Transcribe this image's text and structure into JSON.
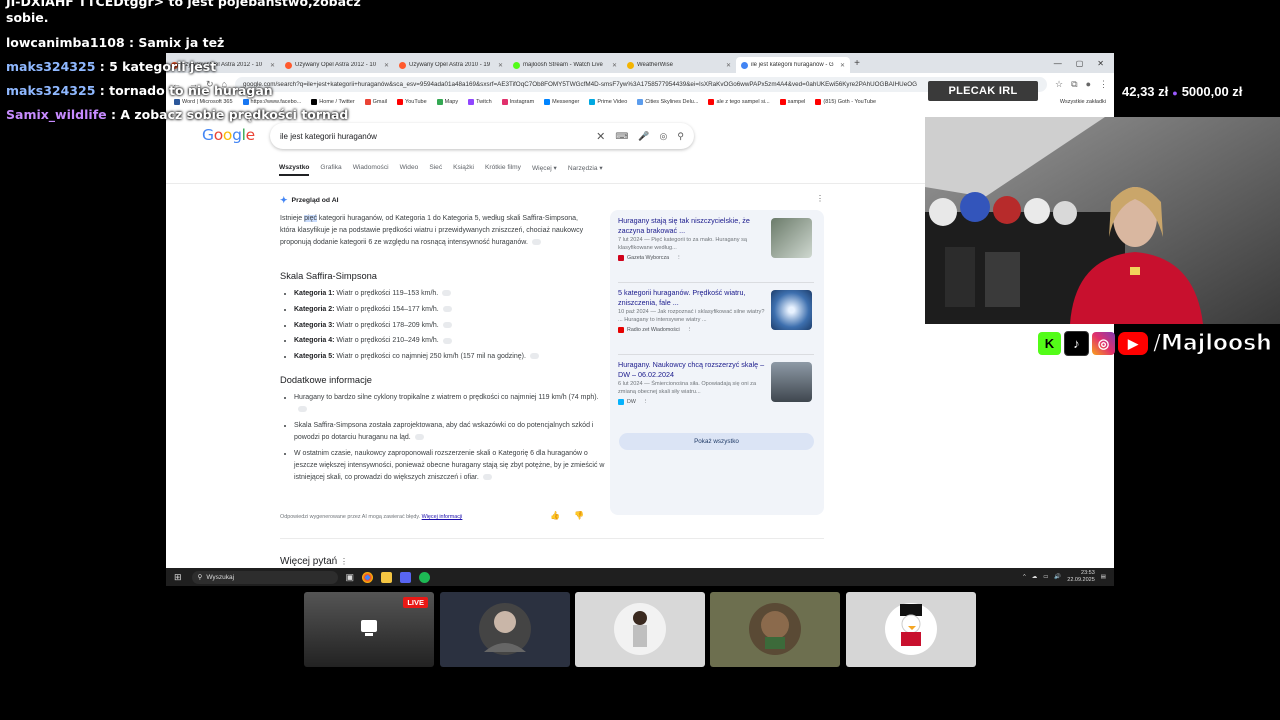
{
  "chat": {
    "lines": [
      {
        "user": "",
        "msg": "JI-DXIAHF TTCEDtggr> to jest pojebaństwo,zobacz"
      },
      {
        "user": "",
        "msg": "sobie."
      },
      {
        "user": "lowcanimba1108",
        "msg": ": Samix ja też",
        "color": "#ffffff"
      },
      {
        "user": "maks324325",
        "msg": ": 5 kategorii jest",
        "color": "#8fb8ff"
      },
      {
        "user": "maks324325",
        "msg": ": tornado to nie huragan",
        "color": "#8fb8ff"
      },
      {
        "user": "Samix_wildlife",
        "msg": ": A zobacz sobie prędkości tornad",
        "color": "#c78bff"
      }
    ]
  },
  "browser": {
    "tabs": [
      {
        "label": "Używany Opel Astra 2012 - 10",
        "fav": "#ff5a2d"
      },
      {
        "label": "Używany Opel Astra 2012 - 10",
        "fav": "#ff5a2d"
      },
      {
        "label": "Używany Opel Astra 2010 - 19",
        "fav": "#ff5a2d"
      },
      {
        "label": "majloosh Stream - Watch Live",
        "fav": "#53fc18"
      },
      {
        "label": "WeatherWise",
        "fav": "#f4b400"
      },
      {
        "label": "ile jest kategorii huraganów - G",
        "fav": "#4285f4",
        "active": true
      }
    ],
    "url": "google.com/search?q=ile+jest+kategorii+huraganów&sca_esv=9594ada01a48a169&sxsrf=AE3TifOqC7Ob8FOMY5TWGcfM4D-smsF7yw%3A1758577954439&ei=IsXRaKvOGo6wwPAPx5zm4A4&ved=0ahUKEwi56Kyre2PAhUOGBAIHUeOG",
    "bookmarks": [
      {
        "label": "Word | Microsoft 365",
        "color": "#2b579a"
      },
      {
        "label": "https://www.facebo...",
        "color": "#1877f2"
      },
      {
        "label": "Home / Twitter",
        "color": "#000000"
      },
      {
        "label": "Gmail",
        "color": "#ea4335"
      },
      {
        "label": "YouTube",
        "color": "#ff0000"
      },
      {
        "label": "Mapy",
        "color": "#34a853"
      },
      {
        "label": "Twitch",
        "color": "#9146ff"
      },
      {
        "label": "Instagram",
        "color": "#e1306c"
      },
      {
        "label": "Messenger",
        "color": "#0084ff"
      },
      {
        "label": "Prime Video",
        "color": "#00a8e1"
      },
      {
        "label": "Cities Skylines Delu...",
        "color": "#5c9ded"
      },
      {
        "label": "ale z tego sampel si...",
        "color": "#ff0000"
      },
      {
        "label": "sampel",
        "color": "#ff0000"
      },
      {
        "label": "(815) Goth - YouTube",
        "color": "#ff0000"
      }
    ],
    "all_bookmarks": "Wszystkie zakładki"
  },
  "google": {
    "logo": "Google",
    "query": "ile jest kategorii huraganów",
    "tabs": [
      "Wszystko",
      "Grafika",
      "Wiadomości",
      "Wideo",
      "Sieć",
      "Książki",
      "Krótkie filmy",
      "Więcej ▾",
      "Narzędzia ▾"
    ],
    "ai_label": "Przegląd od AI",
    "ai_intro_pre": "Istnieje ",
    "ai_intro_hl": "pięć",
    "ai_intro_post": " kategorii huraganów, od Kategoria 1 do Kategoria 5, według skali Saffira-Simpsona, która klasyfikuje je na podstawie prędkości wiatru i przewidywanych zniszczeń, chociaż naukowcy proponują dodanie kategorii 6 ze względu na rosnącą intensywność huraganów.",
    "section1": "Skala Saffira-Simpsona",
    "categories": [
      {
        "name": "Kategoria 1:",
        "text": " Wiatr o prędkości 119–153 km/h."
      },
      {
        "name": "Kategoria 2:",
        "text": " Wiatr o prędkości 154–177 km/h."
      },
      {
        "name": "Kategoria 3:",
        "text": " Wiatr o prędkości 178–209 km/h."
      },
      {
        "name": "Kategoria 4:",
        "text": " Wiatr o prędkości 210–249 km/h."
      },
      {
        "name": "Kategoria 5:",
        "text": " Wiatr o prędkości co najmniej 250 km/h (157 mil na godzinę)."
      }
    ],
    "section2": "Dodatkowe informacje",
    "extra": [
      "Huragany to bardzo silne cyklony tropikalne z wiatrem o prędkości co najmniej 119 km/h (74 mph).",
      "Skala Saffira-Simpsona została zaprojektowana, aby dać wskazówki co do potencjalnych szkód i powodzi po dotarciu huraganu na ląd.",
      "W ostatnim czasie, naukowcy zaproponowali rozszerzenie skali o Kategorię 6 dla huraganów o jeszcze większej intensywności, ponieważ obecne huragany stają się zbyt potężne, by je zmieścić w istniejącej skali, co prowadzi do większych zniszczeń i ofiar."
    ],
    "footnote": "Odpowiedzi wygenerowane przez AI mogą zawierać błędy.",
    "footnote_link": "Więcej informacji",
    "more_questions": "Więcej pytań",
    "sources": [
      {
        "title": "Huragany stają się tak niszczycielskie, że zaczyna brakować ...",
        "snippet": "7 lut 2024 — Pięć kategorii to za mało. Huragany są klasyfikowane według...",
        "publisher": "Gazeta Wyborcza",
        "pubcolor": "#d0021b"
      },
      {
        "title": "5 kategorii huraganów. Prędkość wiatru, zniszczenia, fale ...",
        "snippet": "10 paź 2024 — Jak rozpoznać i sklasyfikować silne wiatry? ... Huragany to intensywne wiatry ...",
        "publisher": "Radio zet Wiadomości",
        "pubcolor": "#e60000"
      },
      {
        "title": "Huragany. Naukowcy chcą rozszerzyć skalę – DW – 06.02.2024",
        "snippet": "6 lut 2024 — Śmiercionośna siła. Opowiadają się oni za zmianą obecnej skali siły wiatru...",
        "publisher": "DW",
        "pubcolor": "#05b2fc"
      }
    ],
    "show_all": "Pokaż wszystko"
  },
  "taskbar": {
    "search": "Wyszukaj",
    "time": "23:53",
    "date": "22.09.2025"
  },
  "overlay": {
    "goal_pill": "PLECAK IRL",
    "money_current": "42,33 zł",
    "money_goal": "5000,00 zł",
    "handle": "/Majloosh",
    "live": "LIVE"
  }
}
